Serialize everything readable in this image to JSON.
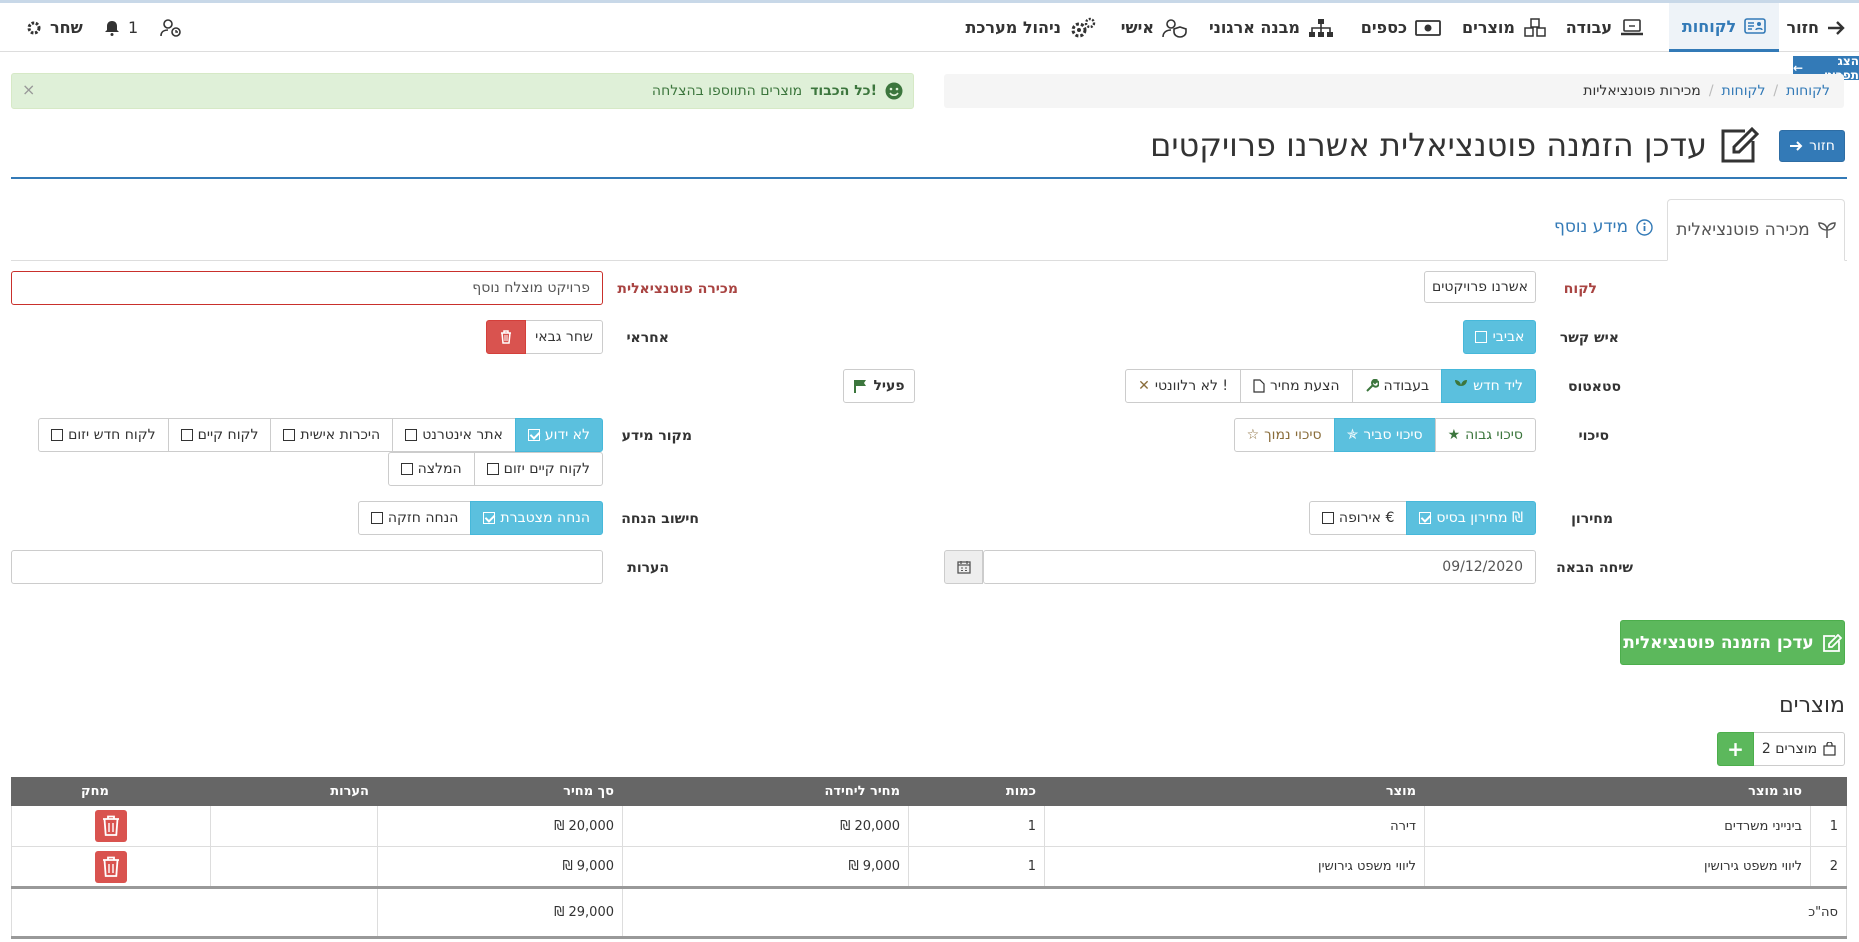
{
  "nav": {
    "back": "חזור",
    "items": [
      "לקוחות",
      "עבודה",
      "מוצרים",
      "כספים",
      "מבנה ארגוני",
      "אישי",
      "ניהול מערכת"
    ],
    "notifications": "1",
    "user": "שחר",
    "print_tab": "הצג תפריט"
  },
  "breadcrumb": [
    "לקוחות",
    "לקוחות",
    "מכירות פוטנציאליות"
  ],
  "alert": {
    "strong": "כל הכבוד!",
    "text": "מוצרים התווספו בהצלחה",
    "close": "×"
  },
  "page": {
    "back_button": "חזור",
    "title": "עדכן הזמנה פוטנציאלית אשרנו פרויקטים"
  },
  "tabs": [
    "מכירה פוטנציאלית",
    "מידע נוסף"
  ],
  "form": {
    "customer_label": "לקוח",
    "customer_value": "אשרנו פרויקטים",
    "contact_label": "איש קשר",
    "contact_value": "אביבי",
    "status_label": "סטאטוס",
    "status_options": [
      "ליד חדש",
      "בעבודה",
      "הצעת מחיר",
      "לא רלוונטי !"
    ],
    "active_label": "פעיל",
    "chance_label": "סיכוי",
    "chance_options": [
      "סיכוי גבוה",
      "סיכוי סביר",
      "סיכוי נמוך"
    ],
    "pricelist_label": "מחירון",
    "pricelist_options": [
      "מחירון בסיס ₪",
      "אירופה €"
    ],
    "next_call_label": "שיחה הבאה",
    "next_call_value": "09/12/2020",
    "sale_label": "מכירה פוטנציאלית",
    "sale_value": "פרויקט מוצלח נוסף",
    "responsible_label": "אחראי",
    "responsible_value": "שחר גבאי",
    "source_label": "מקור מידע",
    "source_options": [
      "לא ידוע",
      "אתר אינטרנט",
      "היכרות אישית",
      "לקוח קיים",
      "לקוח חדש יזום",
      "לקוח קיים יזום",
      "המלצה"
    ],
    "discount_label": "חישוב הנחה",
    "discount_options": [
      "הנחה מצטברת",
      "הנחה חזקה"
    ],
    "notes_label": "הערות",
    "notes_value": ""
  },
  "submit_button": "עדכן הזמנה פוטנציאלית",
  "products": {
    "title": "מוצרים",
    "count_button": "מוצרים 2",
    "add": "+",
    "headers": [
      "סוג מוצר",
      "מוצר",
      "כמות",
      "מחיר ליחידה",
      "סך מחיר",
      "הערות",
      "מחק"
    ],
    "rows": [
      {
        "n": "1",
        "type": "בינייני משרדים",
        "product": "דירה",
        "qty": "1",
        "unit": "20,000 ₪",
        "total": "20,000 ₪",
        "notes": ""
      },
      {
        "n": "2",
        "type": "ליווי משפט גירושין",
        "product": "ליווי משפט גירושין",
        "qty": "1",
        "unit": "9,000 ₪",
        "total": "9,000 ₪",
        "notes": ""
      }
    ],
    "sum_label": "סה\"כ",
    "sum_value": "29,000 ₪"
  },
  "colors": {
    "primary": "#337ab7",
    "success": "#5cb85c",
    "danger": "#d9534f",
    "info": "#5bc0de"
  }
}
